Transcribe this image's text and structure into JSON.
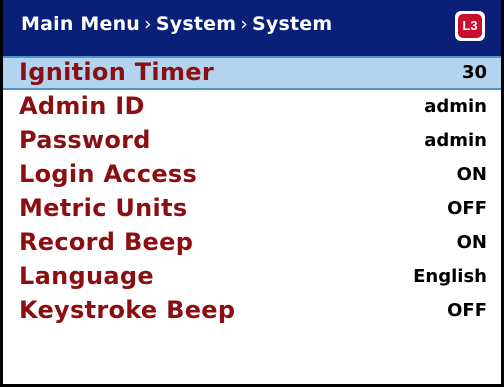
{
  "header": {
    "crumbs": [
      "Main Menu",
      "System",
      "System"
    ],
    "separator": "›",
    "logo_text": "L3",
    "logo_icon": "l3-logo-icon"
  },
  "colors": {
    "header_bg": "#0a1f78",
    "label_text": "#8b0f12",
    "selected_bg": "#b3d4ef",
    "selected_border": "#4f93c9"
  },
  "menu": {
    "items": [
      {
        "label": "Ignition Timer",
        "value": "30",
        "selected": true
      },
      {
        "label": "Admin ID",
        "value": "admin"
      },
      {
        "label": "Password",
        "value": "admin"
      },
      {
        "label": "Login Access",
        "value": "ON"
      },
      {
        "label": "Metric Units",
        "value": "OFF"
      },
      {
        "label": "Record Beep",
        "value": "ON"
      },
      {
        "label": "Language",
        "value": "English"
      },
      {
        "label": "Keystroke Beep",
        "value": "OFF"
      }
    ]
  }
}
